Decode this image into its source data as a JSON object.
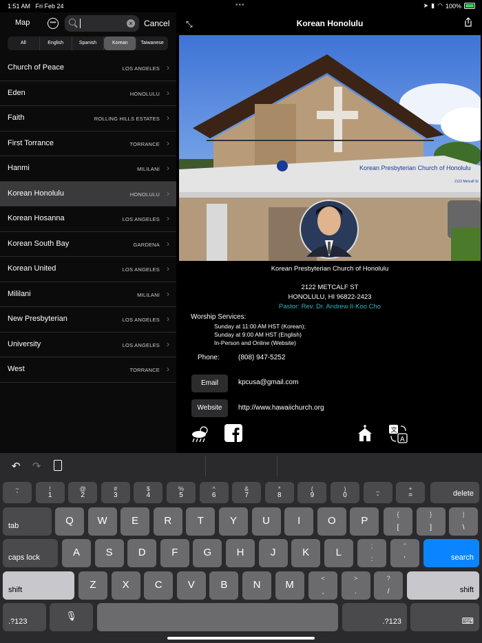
{
  "status": {
    "time": "1:51 AM",
    "date": "Fri Feb 24",
    "battery": "100%"
  },
  "sidebar": {
    "map_label": "Map",
    "search": {
      "value": "",
      "placeholder": ""
    },
    "cancel_label": "Cancel",
    "segments": [
      "All",
      "English",
      "Spanish",
      "Korean",
      "Taiwanese"
    ],
    "selected_segment": "Korean",
    "items": [
      {
        "name": "Church of Peace",
        "city": "LOS ANGELES"
      },
      {
        "name": "Eden",
        "city": "HONOLULU"
      },
      {
        "name": "Faith",
        "city": "ROLLING HILLS ESTATES"
      },
      {
        "name": "First Torrance",
        "city": "TORRANCE"
      },
      {
        "name": "Hanmi",
        "city": "MILILANI"
      },
      {
        "name": "Korean Honolulu",
        "city": "HONOLULU"
      },
      {
        "name": "Korean Hosanna",
        "city": "LOS ANGELES"
      },
      {
        "name": "Korean South Bay",
        "city": "GARDENA"
      },
      {
        "name": "Korean United",
        "city": "LOS ANGELES"
      },
      {
        "name": "Mililani",
        "city": "MILILANI"
      },
      {
        "name": "New Presbyterian",
        "city": "LOS ANGELES"
      },
      {
        "name": "University",
        "city": "LOS ANGELES"
      },
      {
        "name": "West",
        "city": "TORRANCE"
      }
    ],
    "selected_index": 5
  },
  "detail": {
    "title": "Korean Honolulu",
    "caption": "Korean Presbyterian Church of Honolulu",
    "address_line1": "2122 METCALF ST",
    "address_line2": "HONOLULU, HI 96822-2423",
    "pastor": "Pastor: Rev. Dr. Andrew Il-Koo Cho",
    "worship_label": "Worship Services:",
    "worship": [
      "Sunday at 11:00 AM HST (Korean);",
      "Sunday at 9:00 AM HST (English)",
      "In-Person and Online (Website)"
    ],
    "phone_label": "Phone:",
    "phone": "(808) 947-5252",
    "email_label": "Email",
    "email": "kpcusa@gmail.com",
    "website_label": "Website",
    "website": "http://www.hawaiichurch.org",
    "sign_text": "Korean Presbyterian Church of Honolulu",
    "sign_number": "2122 Metcalf St",
    "accent": "#2bb6c2"
  },
  "keyboard": {
    "row1": [
      [
        "~",
        "`"
      ],
      [
        "!",
        "1"
      ],
      [
        "@",
        "2"
      ],
      [
        "#",
        "3"
      ],
      [
        "$",
        "4"
      ],
      [
        "%",
        "5"
      ],
      [
        "^",
        "6"
      ],
      [
        "&",
        "7"
      ],
      [
        "*",
        "8"
      ],
      [
        "(",
        "9"
      ],
      [
        ")",
        "0"
      ],
      [
        "_",
        "-"
      ],
      [
        "+",
        "="
      ]
    ],
    "row2": [
      "Q",
      "W",
      "E",
      "R",
      "T",
      "Y",
      "U",
      "I",
      "O",
      "P"
    ],
    "row2_extra": [
      [
        "{",
        "["
      ],
      [
        "}",
        "]"
      ],
      [
        "|",
        "\\"
      ]
    ],
    "row3": [
      "A",
      "S",
      "D",
      "F",
      "G",
      "H",
      "J",
      "K",
      "L"
    ],
    "row3_extra": [
      [
        ";",
        ":"
      ],
      [
        "”",
        "’"
      ]
    ],
    "row4": [
      "Z",
      "X",
      "C",
      "V",
      "B",
      "N",
      "M"
    ],
    "row4_extra": [
      [
        "<",
        ","
      ],
      [
        ">",
        "."
      ],
      [
        "?",
        "/"
      ]
    ],
    "delete": "delete",
    "tab": "tab",
    "caps": "caps lock",
    "search": "search",
    "shift": "shift",
    "num": ".?123"
  }
}
